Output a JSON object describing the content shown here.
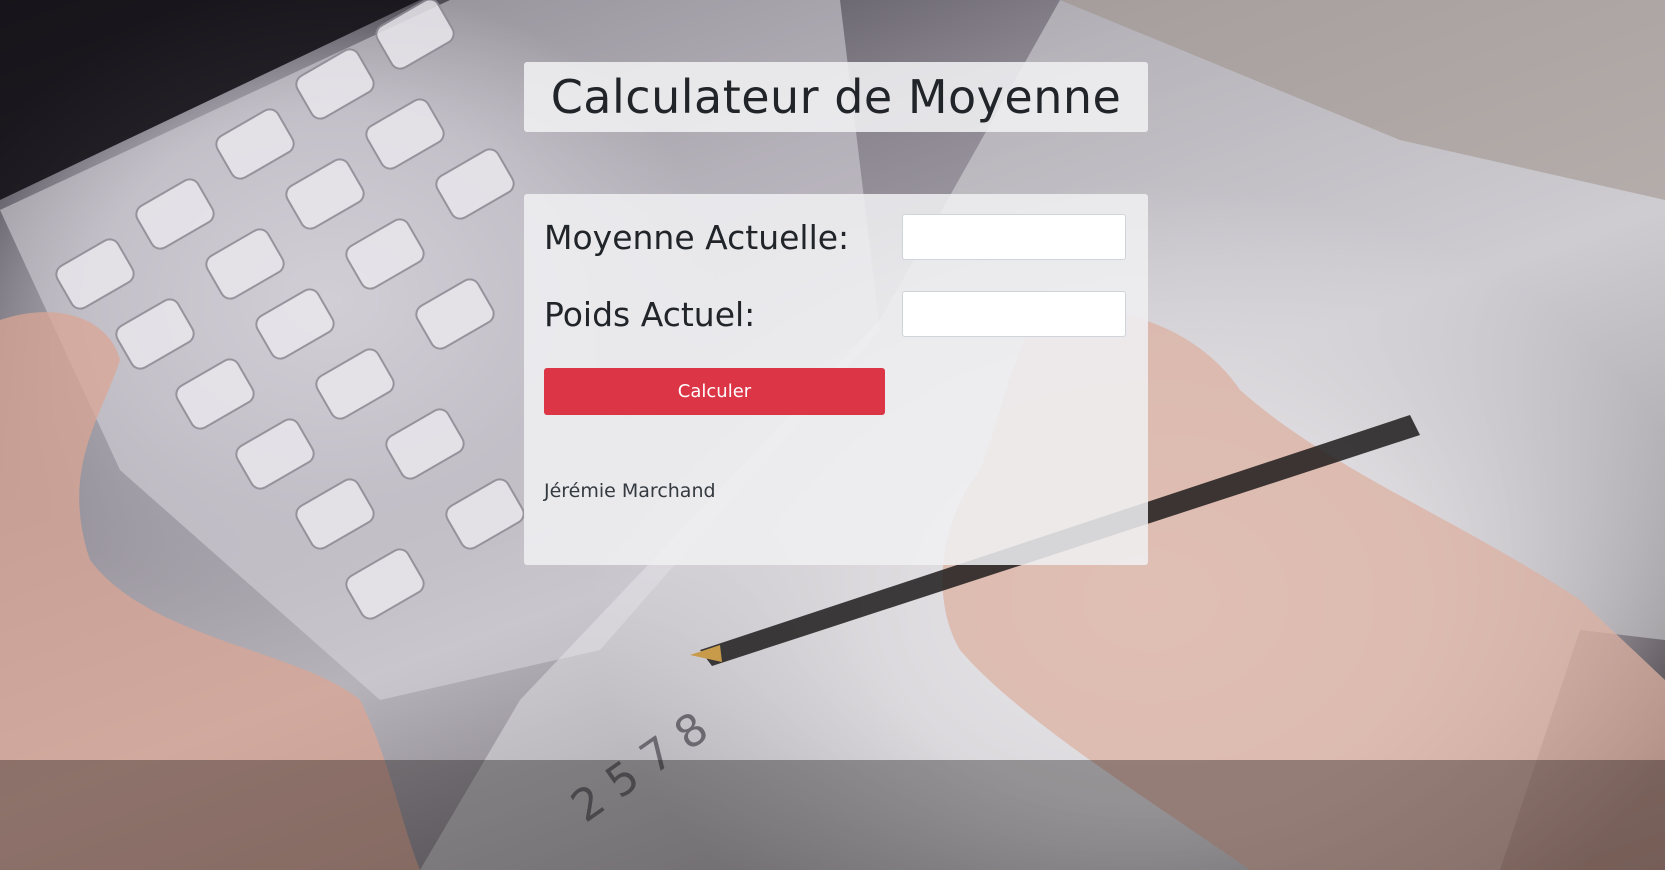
{
  "page": {
    "title": "Calculateur de Moyenne",
    "background_image": "calculator-and-writing-hand-photo"
  },
  "form": {
    "current_average": {
      "label": "Moyenne Actuelle:",
      "value": ""
    },
    "current_weight": {
      "label": "Poids Actuel:",
      "value": ""
    },
    "submit_label": "Calculer"
  },
  "footer": {
    "author": "Jérémie Marchand"
  },
  "colors": {
    "accent": "#dc3545",
    "text": "#212529"
  }
}
